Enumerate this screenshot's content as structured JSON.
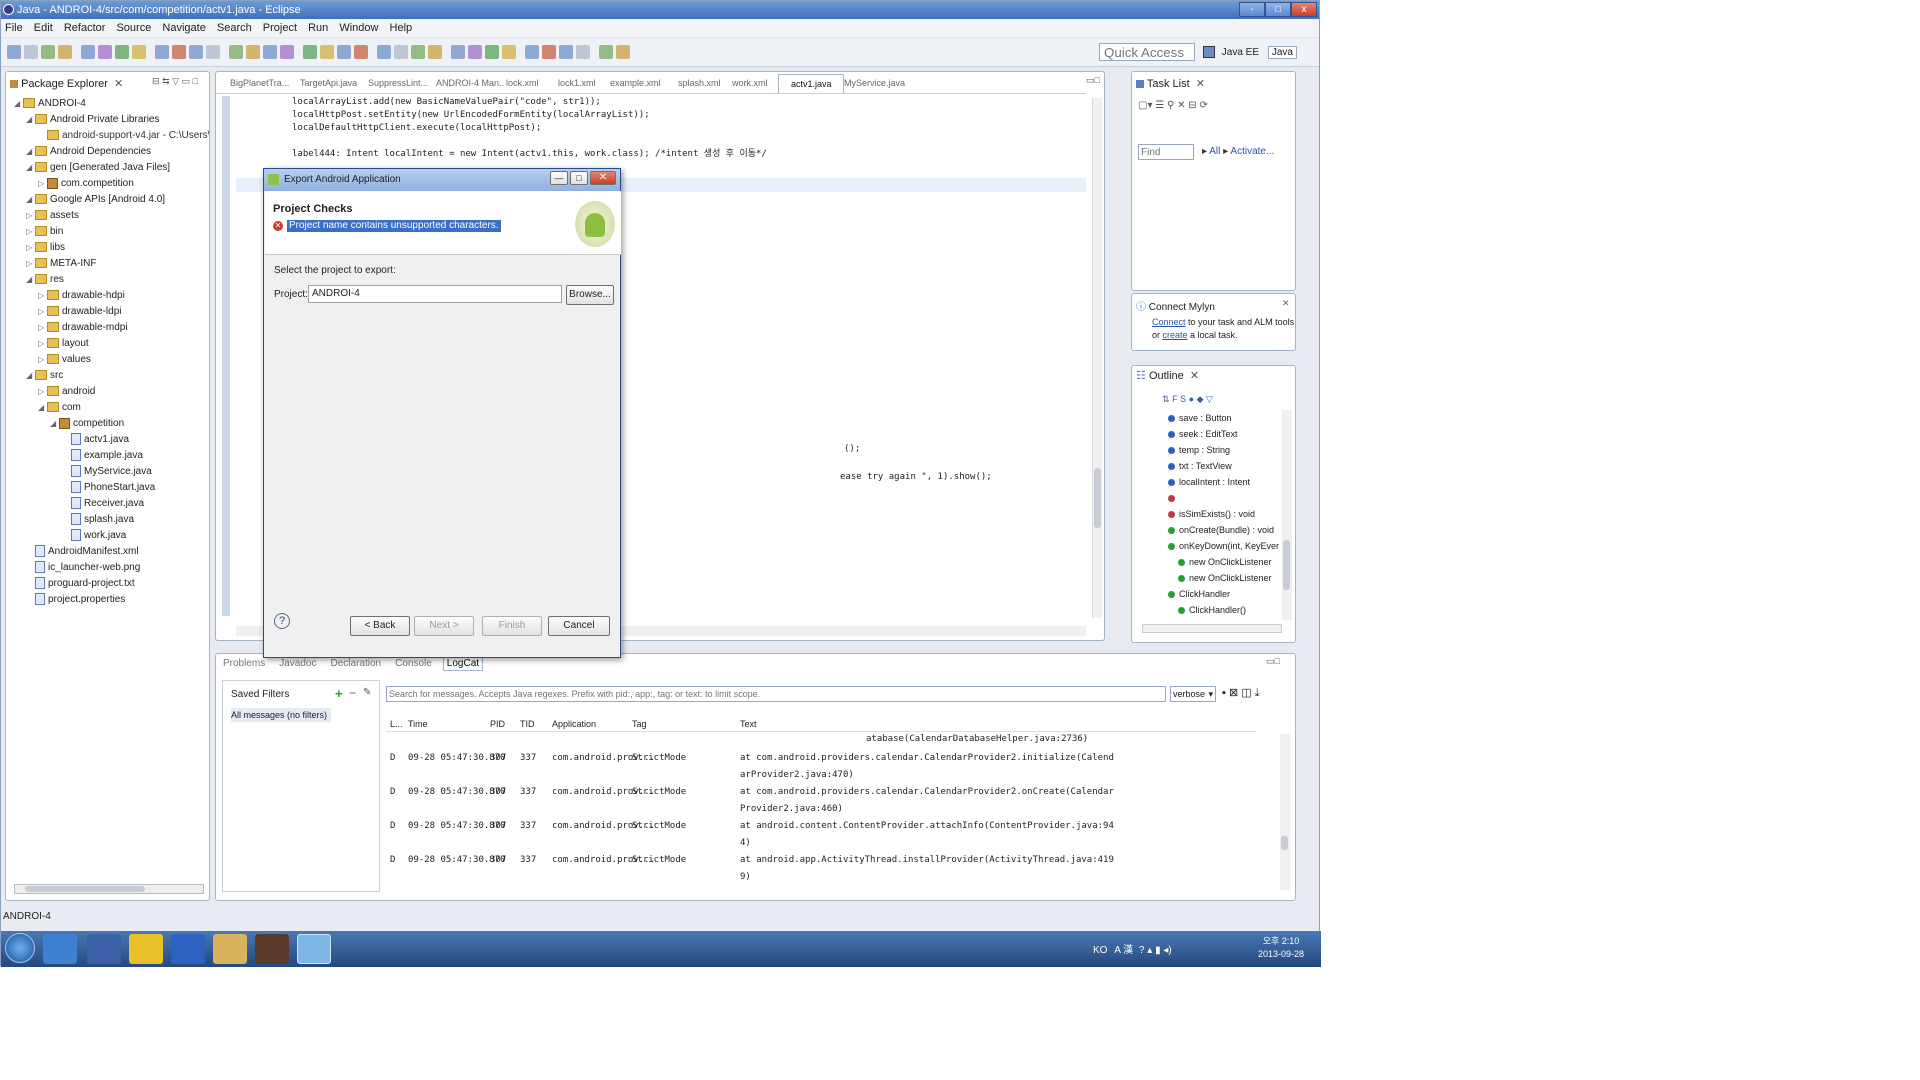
{
  "window": {
    "title": "Java - ANDROI-4/src/com/competition/actv1.java - Eclipse",
    "controls": [
      "-",
      "□",
      "x"
    ]
  },
  "menu": [
    "File",
    "Edit",
    "Refactor",
    "Source",
    "Navigate",
    "Search",
    "Project",
    "Run",
    "Window",
    "Help"
  ],
  "toolbar": {
    "quick_access_placeholder": "Quick Access",
    "perspectives": [
      "Java EE",
      "Java"
    ]
  },
  "package_explorer": {
    "title": "Package Explorer",
    "items": [
      {
        "label": "ANDROI-4",
        "kind": "project"
      },
      {
        "label": "Android Private Libraries",
        "kind": "folder"
      },
      {
        "label": "android-support-v4.jar - C:\\Users\\seoPV",
        "kind": "jar"
      },
      {
        "label": "Android Dependencies",
        "kind": "folder"
      },
      {
        "label": "gen [Generated Java Files]",
        "kind": "folder"
      },
      {
        "label": "com.competition",
        "kind": "package"
      },
      {
        "label": "Google APIs [Android 4.0]",
        "kind": "folder"
      },
      {
        "label": "assets",
        "kind": "folder"
      },
      {
        "label": "bin",
        "kind": "folder"
      },
      {
        "label": "libs",
        "kind": "folder"
      },
      {
        "label": "META-INF",
        "kind": "folder"
      },
      {
        "label": "res",
        "kind": "folder"
      },
      {
        "label": "drawable-hdpi",
        "kind": "folder"
      },
      {
        "label": "drawable-ldpi",
        "kind": "folder"
      },
      {
        "label": "drawable-mdpi",
        "kind": "folder"
      },
      {
        "label": "layout",
        "kind": "folder"
      },
      {
        "label": "values",
        "kind": "folder"
      },
      {
        "label": "src",
        "kind": "folder"
      },
      {
        "label": "android",
        "kind": "folder"
      },
      {
        "label": "com",
        "kind": "folder"
      },
      {
        "label": "competition",
        "kind": "package"
      },
      {
        "label": "actv1.java",
        "kind": "file"
      },
      {
        "label": "example.java",
        "kind": "file"
      },
      {
        "label": "MyService.java",
        "kind": "file"
      },
      {
        "label": "PhoneStart.java",
        "kind": "file"
      },
      {
        "label": "Receiver.java",
        "kind": "file"
      },
      {
        "label": "splash.java",
        "kind": "file"
      },
      {
        "label": "work.java",
        "kind": "file"
      },
      {
        "label": "AndroidManifest.xml",
        "kind": "file"
      },
      {
        "label": "ic_launcher-web.png",
        "kind": "file"
      },
      {
        "label": "proguard-project.txt",
        "kind": "file"
      },
      {
        "label": "project.properties",
        "kind": "file"
      }
    ]
  },
  "editor": {
    "tabs": [
      "BigPlanetTra...",
      "TargetApi.java",
      "SuppressLint...",
      "ANDROI-4 Man...",
      "lock.xml",
      "lock1.xml",
      "example.xml",
      "splash.xml",
      "work.xml",
      "actv1.java",
      "MyService.java"
    ],
    "active_tab": "actv1.java",
    "code_lines": [
      "localArrayList.add(new BasicNameValuePair(\"code\", str1));",
      "localHttpPost.setEntity(new UrlEncodedFormEntity(localArrayList));",
      "localDefaultHttpClient.execute(localHttpPost);",
      "",
      "label444: Intent localIntent = new Intent(actv1.this, work.class); /*intent 생성 후 이동*/"
    ],
    "partial_line_1": "();",
    "partial_line_2": "ease try again \", 1).show();"
  },
  "task_list": {
    "title": "Task List",
    "find_placeholder": "Find",
    "all": "All",
    "activate": "Activate..."
  },
  "connect_mylyn": {
    "title": "Connect Mylyn",
    "connect_link": "Connect",
    "text1": " to your task and ALM tools",
    "text2": "or ",
    "create_link": "create",
    "text3": " a local task."
  },
  "outline": {
    "title": "Outline",
    "items": [
      "save : Button",
      "seek : EditText",
      "temp : String",
      "txt : TextView",
      "localIntent : Intent",
      "",
      "isSimExists() : void",
      "onCreate(Bundle) : void",
      "onKeyDown(int, KeyEver",
      "new OnClickListener",
      "new OnClickListener",
      "ClickHandler",
      "ClickHandler()",
      "..."
    ]
  },
  "dialog": {
    "title": "Export Android Application",
    "section_title": "Project Checks",
    "error_message": "Project name contains unsupported characters.",
    "select_label": "Select the project to export:",
    "project_label": "Project:",
    "project_value": "ANDROI-4",
    "browse": "Browse...",
    "back": "< Back",
    "next": "Next >",
    "finish": "Finish",
    "cancel": "Cancel"
  },
  "bottom": {
    "tabs": [
      "Problems",
      "Javadoc",
      "Declaration",
      "Console",
      "LogCat"
    ],
    "active_tab": "LogCat",
    "saved_filters": "Saved Filters",
    "all_messages": "All messages (no filters)",
    "search_placeholder": "Search for messages. Accepts Java regexes. Prefix with pid:, app:, tag: or text: to limit scope.",
    "level": "verbose",
    "columns": [
      "L...",
      "Time",
      "PID",
      "TID",
      "Application",
      "Tag",
      "Text"
    ],
    "first_text": "atabase(CalendarDatabaseHelper.java:2736)",
    "rows": [
      {
        "level": "D",
        "time": "09-28 05:47:30.870",
        "pid": "307",
        "tid": "337",
        "app": "com.android.prov...",
        "tag": "StrictMode",
        "text1": "at com.android.providers.calendar.CalendarProvider2.initialize(Calend",
        "text2": "arProvider2.java:470)"
      },
      {
        "level": "D",
        "time": "09-28 05:47:30.870",
        "pid": "307",
        "tid": "337",
        "app": "com.android.prov...",
        "tag": "StrictMode",
        "text1": "at com.android.providers.calendar.CalendarProvider2.onCreate(Calendar",
        "text2": "Provider2.java:460)"
      },
      {
        "level": "D",
        "time": "09-28 05:47:30.870",
        "pid": "307",
        "tid": "337",
        "app": "com.android.prov...",
        "tag": "StrictMode",
        "text1": "at android.content.ContentProvider.attachInfo(ContentProvider.java:94",
        "text2": "4)"
      },
      {
        "level": "D",
        "time": "09-28 05:47:30.870",
        "pid": "307",
        "tid": "337",
        "app": "com.android.prov...",
        "tag": "StrictMode",
        "text1": "at android.app.ActivityThread.installProvider(ActivityThread.java:419",
        "text2": "9)"
      }
    ]
  },
  "status_bar": {
    "text": "ANDROI-4"
  },
  "taskbar": {
    "tray_lang": "KO",
    "tray_ime": "A 漢",
    "clock_time": "오후 2:10",
    "clock_date": "2013-09-28"
  }
}
